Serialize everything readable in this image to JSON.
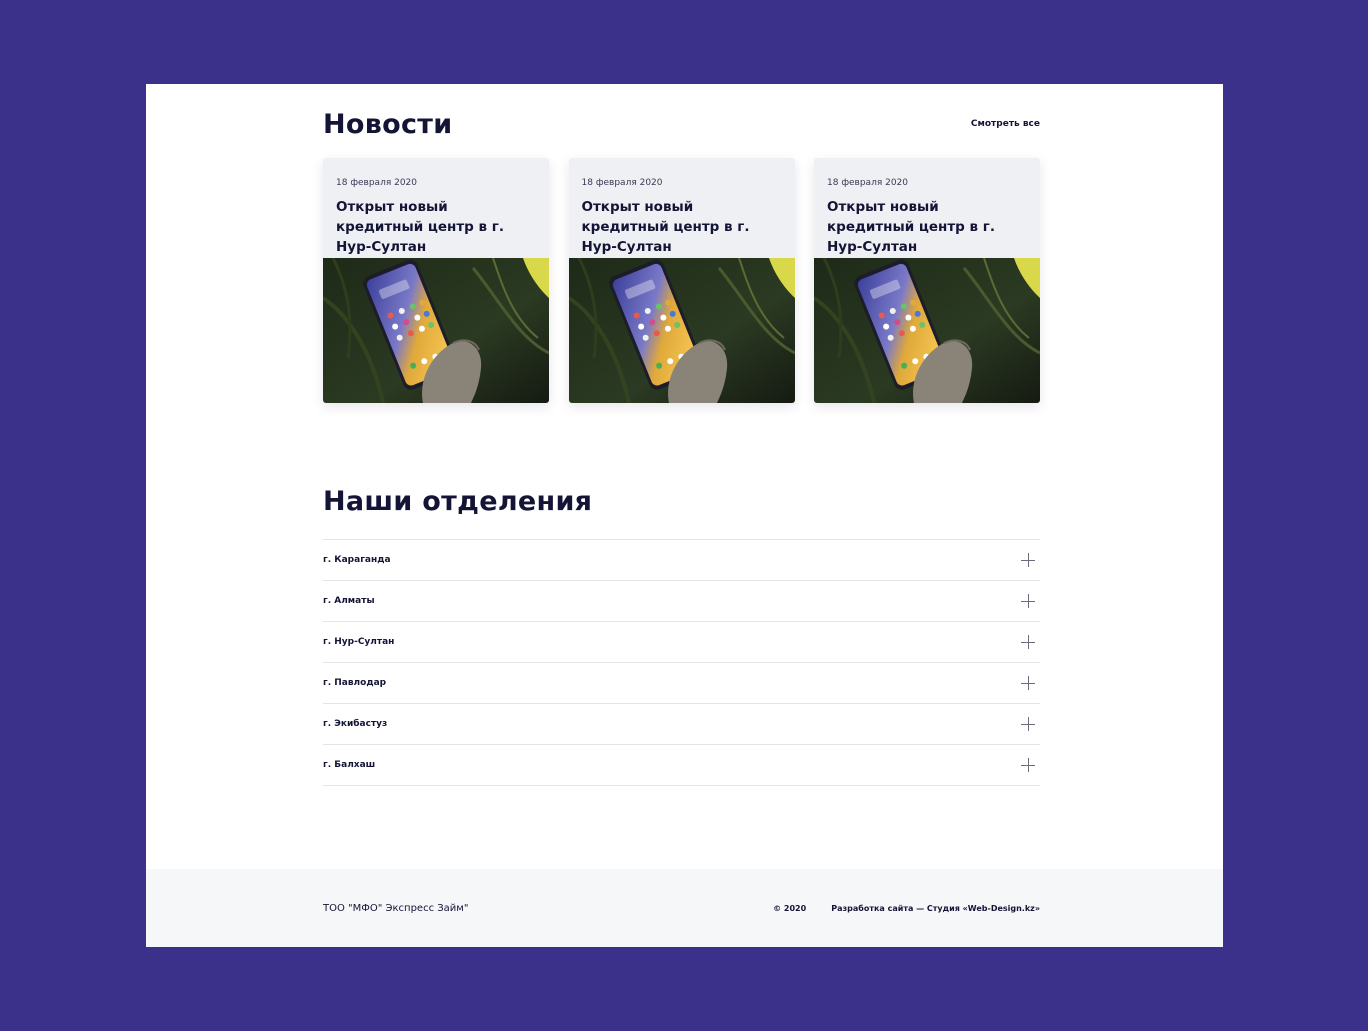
{
  "news": {
    "title": "Новости",
    "see_all": "Смотреть все",
    "cards": [
      {
        "date": "18 февраля 2020",
        "title": "Открыт новый кредитный центр в г. Нур-Султан"
      },
      {
        "date": "18 февраля 2020",
        "title": "Открыт новый кредитный центр в г. Нур-Султан"
      },
      {
        "date": "18 февраля 2020",
        "title": "Открыт новый кредитный центр в г. Нур-Султан"
      }
    ]
  },
  "branches": {
    "title": "Наши отделения",
    "items": [
      {
        "label": "г. Караганда"
      },
      {
        "label": "г. Алматы"
      },
      {
        "label": "г. Нур-Султан"
      },
      {
        "label": "г. Павлодар"
      },
      {
        "label": "г. Экибастуз"
      },
      {
        "label": "г. Балхаш"
      }
    ]
  },
  "footer": {
    "company": "ТОО \"МФО\" Экспресс Займ\"",
    "copyright": "© 2020",
    "developer": "Разработка сайта — Студия «Web-Design.kz»"
  },
  "colors": {
    "outer_background": "#3c318a",
    "text_dark": "#141436",
    "card_background": "#eef0f3",
    "footer_background": "#f6f7f9"
  }
}
